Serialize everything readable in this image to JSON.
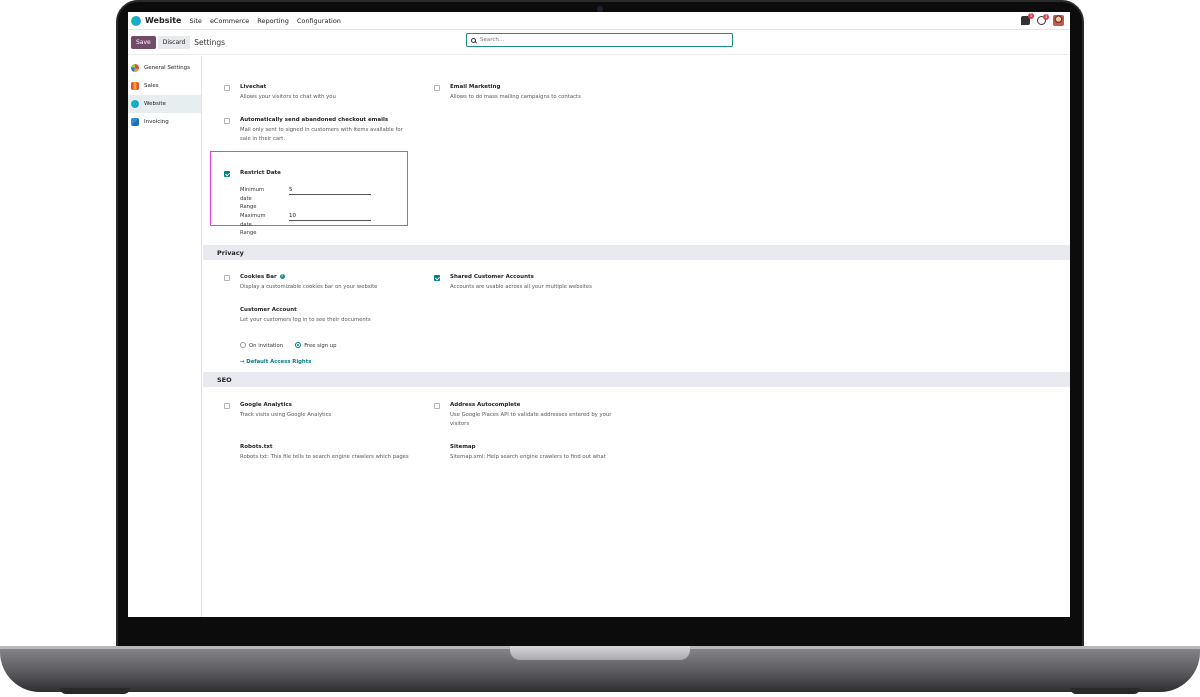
{
  "navbar": {
    "app_name": "Website",
    "menu": [
      "Site",
      "eCommerce",
      "Reporting",
      "Configuration"
    ],
    "chat_badge": "1",
    "activity_badge": "3"
  },
  "control_panel": {
    "save_label": "Save",
    "discard_label": "Discard",
    "title": "Settings",
    "search_placeholder": "Search..."
  },
  "sidebar": {
    "items": [
      {
        "label": "General Settings",
        "icon": "general-settings-icon"
      },
      {
        "label": "Sales",
        "icon": "sales-app-icon"
      },
      {
        "label": "Website",
        "icon": "website-app-icon",
        "active": true
      },
      {
        "label": "Invoicing",
        "icon": "invoicing-app-icon"
      }
    ]
  },
  "top_settings": {
    "livechat": {
      "title": "Livechat",
      "desc": "Allows your visitors to chat with you",
      "checked": false
    },
    "email_marketing": {
      "title": "Email Marketing",
      "desc": "Allows to do mass mailing campaigns to contacts",
      "checked": false
    },
    "abandoned": {
      "title": "Automatically send abandoned checkout emails",
      "desc_line1": "Mail only sent to signed in customers with items available for",
      "desc_line2": "sale in their cart.",
      "checked": false
    },
    "restrict_date": {
      "title": "Restrict Date",
      "checked": true,
      "min_label_1": "Minimum",
      "min_label_2": "date Range",
      "min_value": "5",
      "max_label_1": "Maximum",
      "max_label_2": "date Range",
      "max_value": "10"
    }
  },
  "privacy": {
    "header": "Privacy",
    "cookies_bar": {
      "title": "Cookies Bar",
      "desc": "Display a customizable cookies bar on your website",
      "checked": false
    },
    "shared_accounts": {
      "title": "Shared Customer Accounts",
      "desc": "Accounts are usable across all your multiple websites",
      "checked": true
    },
    "customer_account": {
      "title": "Customer Account",
      "desc": "Let your customers log in to see their documents",
      "option_1": "On invitation",
      "option_2": "Free sign up",
      "selected": "Free sign up",
      "link": "Default Access Rights"
    }
  },
  "seo": {
    "header": "SEO",
    "google_analytics": {
      "title": "Google Analytics",
      "desc": "Track visits using Google Analytics",
      "checked": false
    },
    "address_autocomplete": {
      "title": "Address Autocomplete",
      "desc_line1": "Use Google Places API to validate addresses entered by your",
      "desc_line2": "visitors",
      "checked": false
    },
    "robots": {
      "title": "Robots.txt",
      "desc": "Robots.txt: This file tells to search engine crawlers which pages"
    },
    "sitemap": {
      "title": "Sitemap",
      "desc": "Sitemap.xml: Help search engine crawlers to find out what"
    }
  }
}
